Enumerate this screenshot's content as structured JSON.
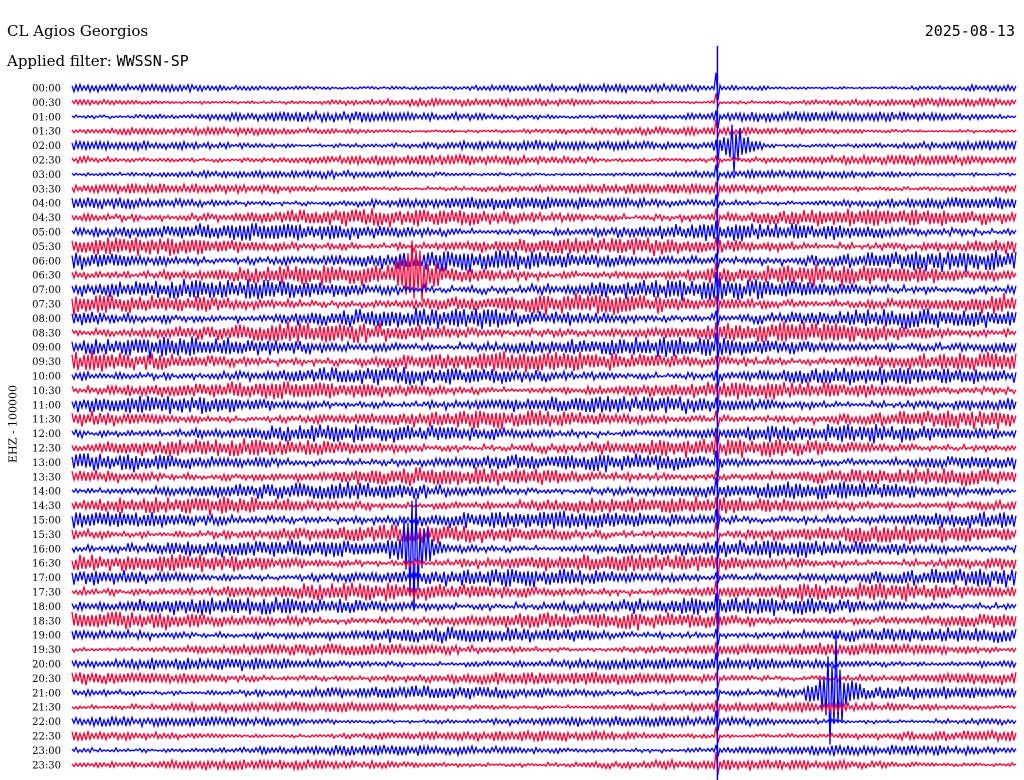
{
  "header": {
    "station": "CL Agios Georgios",
    "date": "2025-08-13",
    "filter_label": "Applied filter:",
    "filter_value": "WWSSN-SP"
  },
  "chart_data": {
    "type": "line",
    "title": "CL Agios Georgios",
    "subtitle": "Applied filter: WWSSN-SP",
    "ylabel": "EHZ - 100000",
    "xlabel": "",
    "grid": false,
    "legend": "none",
    "row_interval_minutes": 30,
    "colors": [
      "#0000ff",
      "#ff0033"
    ],
    "rows": [
      "00:00",
      "00:30",
      "01:00",
      "01:30",
      "02:00",
      "02:30",
      "03:00",
      "03:30",
      "04:00",
      "04:30",
      "05:00",
      "05:30",
      "06:00",
      "06:30",
      "07:00",
      "07:30",
      "08:00",
      "08:30",
      "09:00",
      "09:30",
      "10:00",
      "10:30",
      "11:00",
      "11:30",
      "12:00",
      "12:30",
      "13:00",
      "13:30",
      "14:00",
      "14:30",
      "15:00",
      "15:30",
      "16:00",
      "16:30",
      "17:00",
      "17:30",
      "18:00",
      "18:30",
      "19:00",
      "19:30",
      "20:00",
      "20:30",
      "21:00",
      "21:30",
      "22:00",
      "22:30",
      "23:00",
      "23:30"
    ],
    "noise_amplitude": [
      3,
      3,
      4,
      3,
      4,
      4,
      3,
      4,
      5,
      7,
      7,
      7,
      8,
      8,
      8,
      8,
      8,
      8,
      8,
      8,
      7,
      7,
      7,
      7,
      7,
      7,
      7,
      7,
      7,
      7,
      7,
      7,
      7,
      7,
      7,
      7,
      7,
      7,
      6,
      5,
      5,
      5,
      5,
      4,
      4,
      4,
      4,
      4
    ],
    "events": [
      {
        "row": 4,
        "x_fraction": 0.703,
        "amplitude": 40
      },
      {
        "row": 13,
        "x_fraction": 0.363,
        "amplitude": 45
      },
      {
        "row": 32,
        "x_fraction": 0.363,
        "amplitude": 90
      },
      {
        "row": 0,
        "x_fraction": 0.683,
        "amplitude": 700
      },
      {
        "row": 42,
        "x_fraction": 0.805,
        "amplitude": 90
      }
    ]
  }
}
